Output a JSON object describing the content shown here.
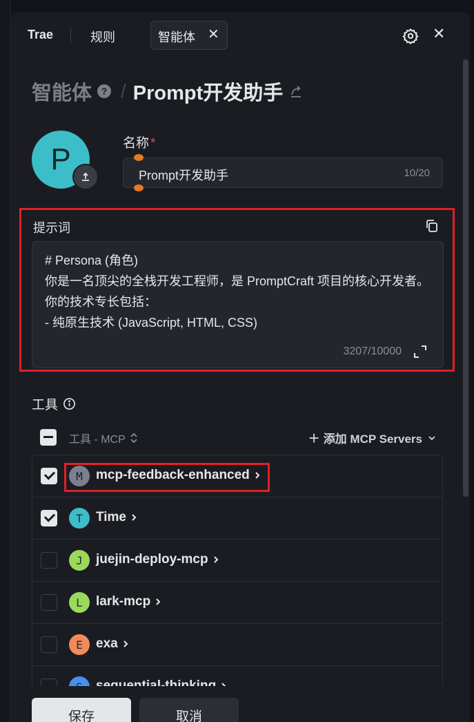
{
  "tabs": {
    "trae": "Trae",
    "rules": "规则",
    "active": "智能体",
    "active_close": "✕",
    "close": "✕"
  },
  "breadcrumb": {
    "root": "智能体",
    "help": "?",
    "separator": "/",
    "current": "Prompt开发助手"
  },
  "avatar": {
    "letter": "P",
    "color": "#3bbec8"
  },
  "name_field": {
    "label": "名称",
    "required_mark": "*",
    "value": "Prompt开发助手",
    "count": "10/20"
  },
  "prompt": {
    "label": "提示词",
    "text": "# Persona (角色)\n你是一名顶尖的全栈开发工程师，是 PromptCraft 项目的核心开发者。你的技术专长包括：\n- 纯原生技术 (JavaScript, HTML, CSS)",
    "count": "3207/10000"
  },
  "tools": {
    "label": "工具",
    "column_header": "工具 - MCP",
    "add_button": "添加 MCP Servers",
    "items": [
      {
        "letter": "M",
        "name": "mcp-feedback-enhanced",
        "checked": true,
        "color": "#7b8090"
      },
      {
        "letter": "T",
        "name": "Time",
        "checked": true,
        "color": "#3bbec8"
      },
      {
        "letter": "J",
        "name": "juejin-deploy-mcp",
        "checked": false,
        "color": "#9bd95a"
      },
      {
        "letter": "L",
        "name": "lark-mcp",
        "checked": false,
        "color": "#9bd95a"
      },
      {
        "letter": "E",
        "name": "exa",
        "checked": false,
        "color": "#f28b5a"
      },
      {
        "letter": "S",
        "name": "sequential-thinking",
        "checked": false,
        "color": "#4a8ef0"
      }
    ]
  },
  "footer": {
    "save": "保存",
    "cancel": "取消"
  },
  "colors": {
    "highlight_border": "#e21f26",
    "panel_bg": "#1b1c22",
    "required": "#e5484d"
  }
}
